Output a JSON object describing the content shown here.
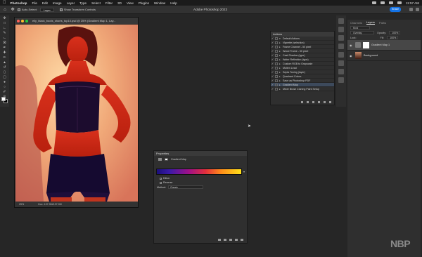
{
  "menubar": {
    "app": "Photoshop",
    "items": [
      "File",
      "Edit",
      "Image",
      "Layer",
      "Type",
      "Select",
      "Filter",
      "3D",
      "View",
      "Plugins",
      "Window",
      "Help"
    ],
    "clock": "11:57 AM"
  },
  "options": {
    "auto_select": "Auto-Select:",
    "layer_select": "Layer",
    "transform": "Show Transform Controls",
    "window_title": "Adobe Photoshop 2023",
    "share": "Share"
  },
  "document": {
    "title": "elly_black_boots_shorts_top10.psd @ 25% (Gradient Map 1, Lay...",
    "zoom": "25%",
    "doc_info": "Doc: 137.9M/137.9M"
  },
  "actions_panel": {
    "title": "Actions",
    "items": [
      {
        "label": "Default Actions",
        "selected": false
      },
      {
        "label": "Vignette (selection)",
        "selected": false
      },
      {
        "label": "Frame Channel - 50 pixel",
        "selected": false
      },
      {
        "label": "Wood Frame - 50 pixel",
        "selected": false
      },
      {
        "label": "Cast Shadow (type)",
        "selected": false
      },
      {
        "label": "Water Reflection (type)",
        "selected": false
      },
      {
        "label": "Custom RGB to Grayscale",
        "selected": false
      },
      {
        "label": "Molten Lead",
        "selected": false
      },
      {
        "label": "Sepia Toning (layer)",
        "selected": false
      },
      {
        "label": "Quadrant Colors",
        "selected": false
      },
      {
        "label": "Save as Photoshop PDF",
        "selected": false
      },
      {
        "label": "Gradient Map",
        "selected": true
      },
      {
        "label": "Mixer Brush Cloning Paint Setup",
        "selected": false
      }
    ]
  },
  "layers_panel": {
    "tabs": [
      "Channels",
      "Layers",
      "Paths"
    ],
    "active_tab": "Layers",
    "kind": "Kind",
    "blend_mode": "Overlay",
    "opacity_label": "Opacity:",
    "opacity": "100%",
    "lock_label": "Lock:",
    "fill_label": "Fill:",
    "fill": "100%",
    "layers": [
      {
        "name": "Gradient Map 1",
        "selected": true
      },
      {
        "name": "Background",
        "selected": false
      }
    ]
  },
  "properties_panel": {
    "title": "Properties",
    "type": "Gradient Map",
    "dither": "Dither",
    "reverse": "Reverse",
    "method_label": "Method:",
    "method": "Classic"
  },
  "watermark": "NBP"
}
